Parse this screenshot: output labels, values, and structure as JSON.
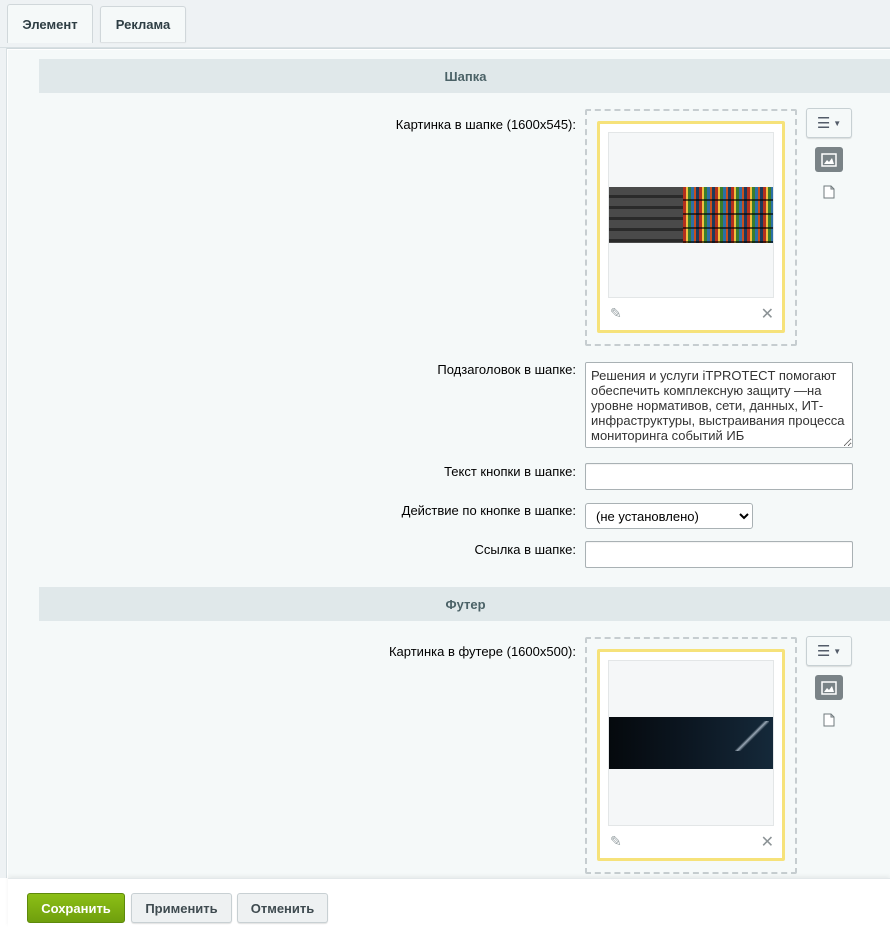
{
  "tabs": [
    {
      "label": "Элемент",
      "active": true
    },
    {
      "label": "Реклама",
      "active": false
    }
  ],
  "sections": {
    "header": {
      "title": "Шапка",
      "image_label": "Картинка в шапке (1600x545):",
      "subtitle_label": "Подзаголовок в шапке:",
      "subtitle_value": "Решения и услуги iTPROTECT помогают обеспечить комплексную защиту —на уровне нормативов, сети, данных, ИТ-инфраструктуры, выстраивания процесса мониторинга событий ИБ",
      "button_text_label": "Текст кнопки в шапке:",
      "button_text_value": "",
      "action_label": "Действие по кнопке в шапке:",
      "action_selected": "(не установлено)",
      "link_label": "Ссылка в шапке:",
      "link_value": ""
    },
    "footer": {
      "title": "Футер",
      "image_label": "Картинка в футере (1600x500):"
    }
  },
  "icons": {
    "menu": "menu-lines-icon",
    "caret": "caret-down-icon",
    "image": "image-icon",
    "file": "file-icon",
    "edit": "pencil-icon",
    "delete": "close-icon"
  },
  "buttons": {
    "save": "Сохранить",
    "apply": "Применить",
    "cancel": "Отменить"
  },
  "colors": {
    "save_green": "#7aab12",
    "image_frame_yellow": "#f6e27a",
    "section_header_bg": "#e0e8ea"
  }
}
